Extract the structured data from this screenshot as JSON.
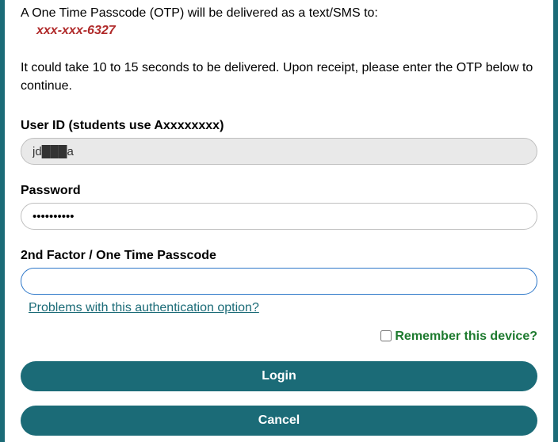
{
  "intro": {
    "line1": "A One Time Passcode (OTP) will be delivered as a text/SMS to:",
    "phone_masked": "xxx-xxx-6327",
    "line2": "It could take 10 to 15 seconds to be delivered. Upon receipt, please enter the OTP below to continue."
  },
  "fields": {
    "userid_label": "User ID (students use Axxxxxxxx)",
    "userid_value": "jd███a",
    "password_label": "Password",
    "password_value": "••••••••••",
    "otp_label": "2nd Factor / One Time Passcode",
    "otp_value": ""
  },
  "links": {
    "problems": "Problems with this authentication option?"
  },
  "remember": {
    "label": "Remember this device?",
    "checked": false
  },
  "buttons": {
    "login": "Login",
    "cancel": "Cancel"
  }
}
